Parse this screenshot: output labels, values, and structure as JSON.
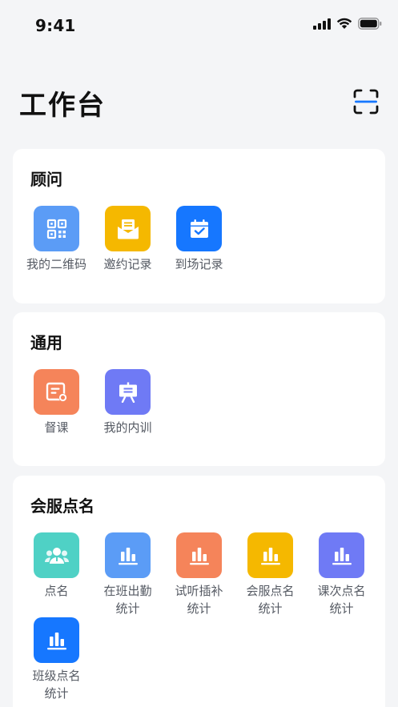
{
  "status_bar": {
    "time": "9:41"
  },
  "header": {
    "title": "工作台"
  },
  "sections": [
    {
      "title": "顾问",
      "items": [
        {
          "label": "我的二维码",
          "icon": "qr-code-icon",
          "color": "#5b9cf6"
        },
        {
          "label": "邀约记录",
          "icon": "envelope-icon",
          "color": "#f5b800"
        },
        {
          "label": "到场记录",
          "icon": "calendar-check-icon",
          "color": "#1677ff"
        }
      ]
    },
    {
      "title": "通用",
      "items": [
        {
          "label": "督课",
          "icon": "document-settings-icon",
          "color": "#f5845a"
        },
        {
          "label": "我的内训",
          "icon": "presentation-board-icon",
          "color": "#6f7af5"
        }
      ]
    },
    {
      "title": "会服点名",
      "items": [
        {
          "label": "点名",
          "icon": "people-icon",
          "color": "#4fd1c5"
        },
        {
          "label": "在班出勤\n统计",
          "icon": "bar-chart-icon",
          "color": "#5b9cf6"
        },
        {
          "label": "试听插补\n统计",
          "icon": "bar-chart-icon",
          "color": "#f5845a"
        },
        {
          "label": "会服点名\n统计",
          "icon": "bar-chart-icon",
          "color": "#f5b800"
        },
        {
          "label": "课次点名\n统计",
          "icon": "bar-chart-icon",
          "color": "#6f7af5"
        },
        {
          "label": "班级点名\n统计",
          "icon": "bar-chart-icon",
          "color": "#1677ff"
        }
      ]
    }
  ]
}
